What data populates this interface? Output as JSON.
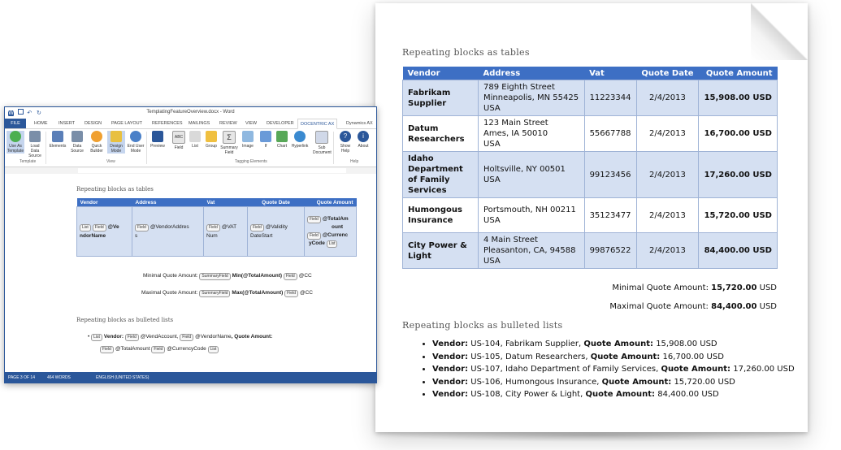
{
  "doc": {
    "table_heading": "Repeating blocks as tables",
    "columns": [
      "Vendor",
      "Address",
      "Vat",
      "Quote Date",
      "Quote Amount"
    ],
    "rows": [
      {
        "vendor": "Fabrikam Supplier",
        "address": [
          "789 Eighth Street",
          "Minneapolis, MN 55425",
          "USA"
        ],
        "vat": "11223344",
        "date": "2/4/2013",
        "amount": "15,908.00 USD"
      },
      {
        "vendor": "Datum Researchers",
        "address": [
          "123 Main Street",
          "Ames, IA 50010",
          "USA"
        ],
        "vat": "55667788",
        "date": "2/4/2013",
        "amount": "16,700.00 USD"
      },
      {
        "vendor": "Idaho Department of Family Services",
        "address": [
          "Holtsville, NY 00501",
          "USA"
        ],
        "vat": "99123456",
        "date": "2/4/2013",
        "amount": "17,260.00 USD"
      },
      {
        "vendor": "Humongous Insurance",
        "address": [
          "Portsmouth, NH 00211",
          "USA"
        ],
        "vat": "35123477",
        "date": "2/4/2013",
        "amount": "15,720.00 USD"
      },
      {
        "vendor": "City Power & Light",
        "address": [
          "4 Main Street",
          "Pleasanton, CA, 94588",
          "USA"
        ],
        "vat": "99876522",
        "date": "2/4/2013",
        "amount": "84,400.00 USD"
      }
    ],
    "min_label": "Minimal Quote Amount:",
    "min_value": "15,720.00",
    "min_currency": "USD",
    "max_label": "Maximal Quote Amount:",
    "max_value": "84,400.00",
    "max_currency": "USD",
    "list_heading": "Repeating blocks as bulleted lists",
    "list_vendor_label": "Vendor:",
    "list_amount_label": "Quote Amount:",
    "list_items": [
      {
        "vendor": "US-104, Fabrikam Supplier,",
        "amount": "15,908.00 USD"
      },
      {
        "vendor": "US-105, Datum Researchers,",
        "amount": "16,700.00 USD"
      },
      {
        "vendor": "US-107, Idaho Department of Family Services,",
        "amount": "17,260.00 USD"
      },
      {
        "vendor": "US-106, Humongous Insurance,",
        "amount": "15,720.00 USD"
      },
      {
        "vendor": "US-108, City Power & Light,",
        "amount": "84,400.00 USD"
      }
    ]
  },
  "word": {
    "title": "TemplatingFeatureOverview.docx - Word",
    "file_tab": "FILE",
    "tabs": [
      "HOME",
      "INSERT",
      "DESIGN",
      "PAGE LAYOUT",
      "REFERENCES",
      "MAILINGS",
      "REVIEW",
      "VIEW",
      "DEVELOPER",
      "DOCENTRIC AX",
      "Dynamics AX"
    ],
    "ribbon_buttons": [
      "Use As Template",
      "Load Data Source",
      "Elements",
      "Data Source",
      "Quick Builder",
      "Design Mode",
      "End User Mode",
      "Preview",
      "Field",
      "List",
      "Group",
      "Summary Field",
      "Image",
      "If",
      "Chart",
      "Hyperlink",
      "Sub Document",
      "Show Help",
      "About"
    ],
    "groups": [
      "Template",
      "View",
      "Tagging Elements",
      "Help"
    ],
    "status_page": "PAGE 3 OF 14",
    "status_words": "464 WORDS",
    "status_lang": "ENGLISH (UNITED STATES)",
    "table_heading": "Repeating blocks as tables",
    "table_columns": [
      "Vendor",
      "Address",
      "Vat",
      "Quote Date",
      "Quote Amount"
    ],
    "tag_list": "List",
    "tag_field": "Field",
    "tag_summary": "SummaryField",
    "vendor_expr_a": "@Ve",
    "vendor_expr_b": "ndorName",
    "address_expr_a": "@VendorAddres",
    "address_expr_b": "s",
    "vat_expr_a": "@VAT",
    "vat_expr_b": "Num",
    "date_expr_a": "@Validity",
    "date_expr_b": "DateStart",
    "amount_expr_a": "@TotalAm",
    "amount_expr_b": "ount",
    "currency_expr_a": "@Currenc",
    "currency_expr_b": "yCode",
    "min_label": "Minimal Quote Amount:",
    "min_expr": "Min(@TotalAmount)",
    "max_label": "Maximal Quote Amount:",
    "max_expr": "Max(@TotalAmount)",
    "cc_expr": "@CC",
    "list_heading": "Repeating blocks as bulleted lists",
    "list_vendor_label": "Vendor:",
    "list_account_expr": "@VendAccount",
    "list_comma": ",",
    "list_name_expr": "@VendorName",
    "list_amount_label": ", Quote Amount:",
    "list_total_expr": "@TotalAmount",
    "list_currency_expr": "@CurrencyCode"
  }
}
